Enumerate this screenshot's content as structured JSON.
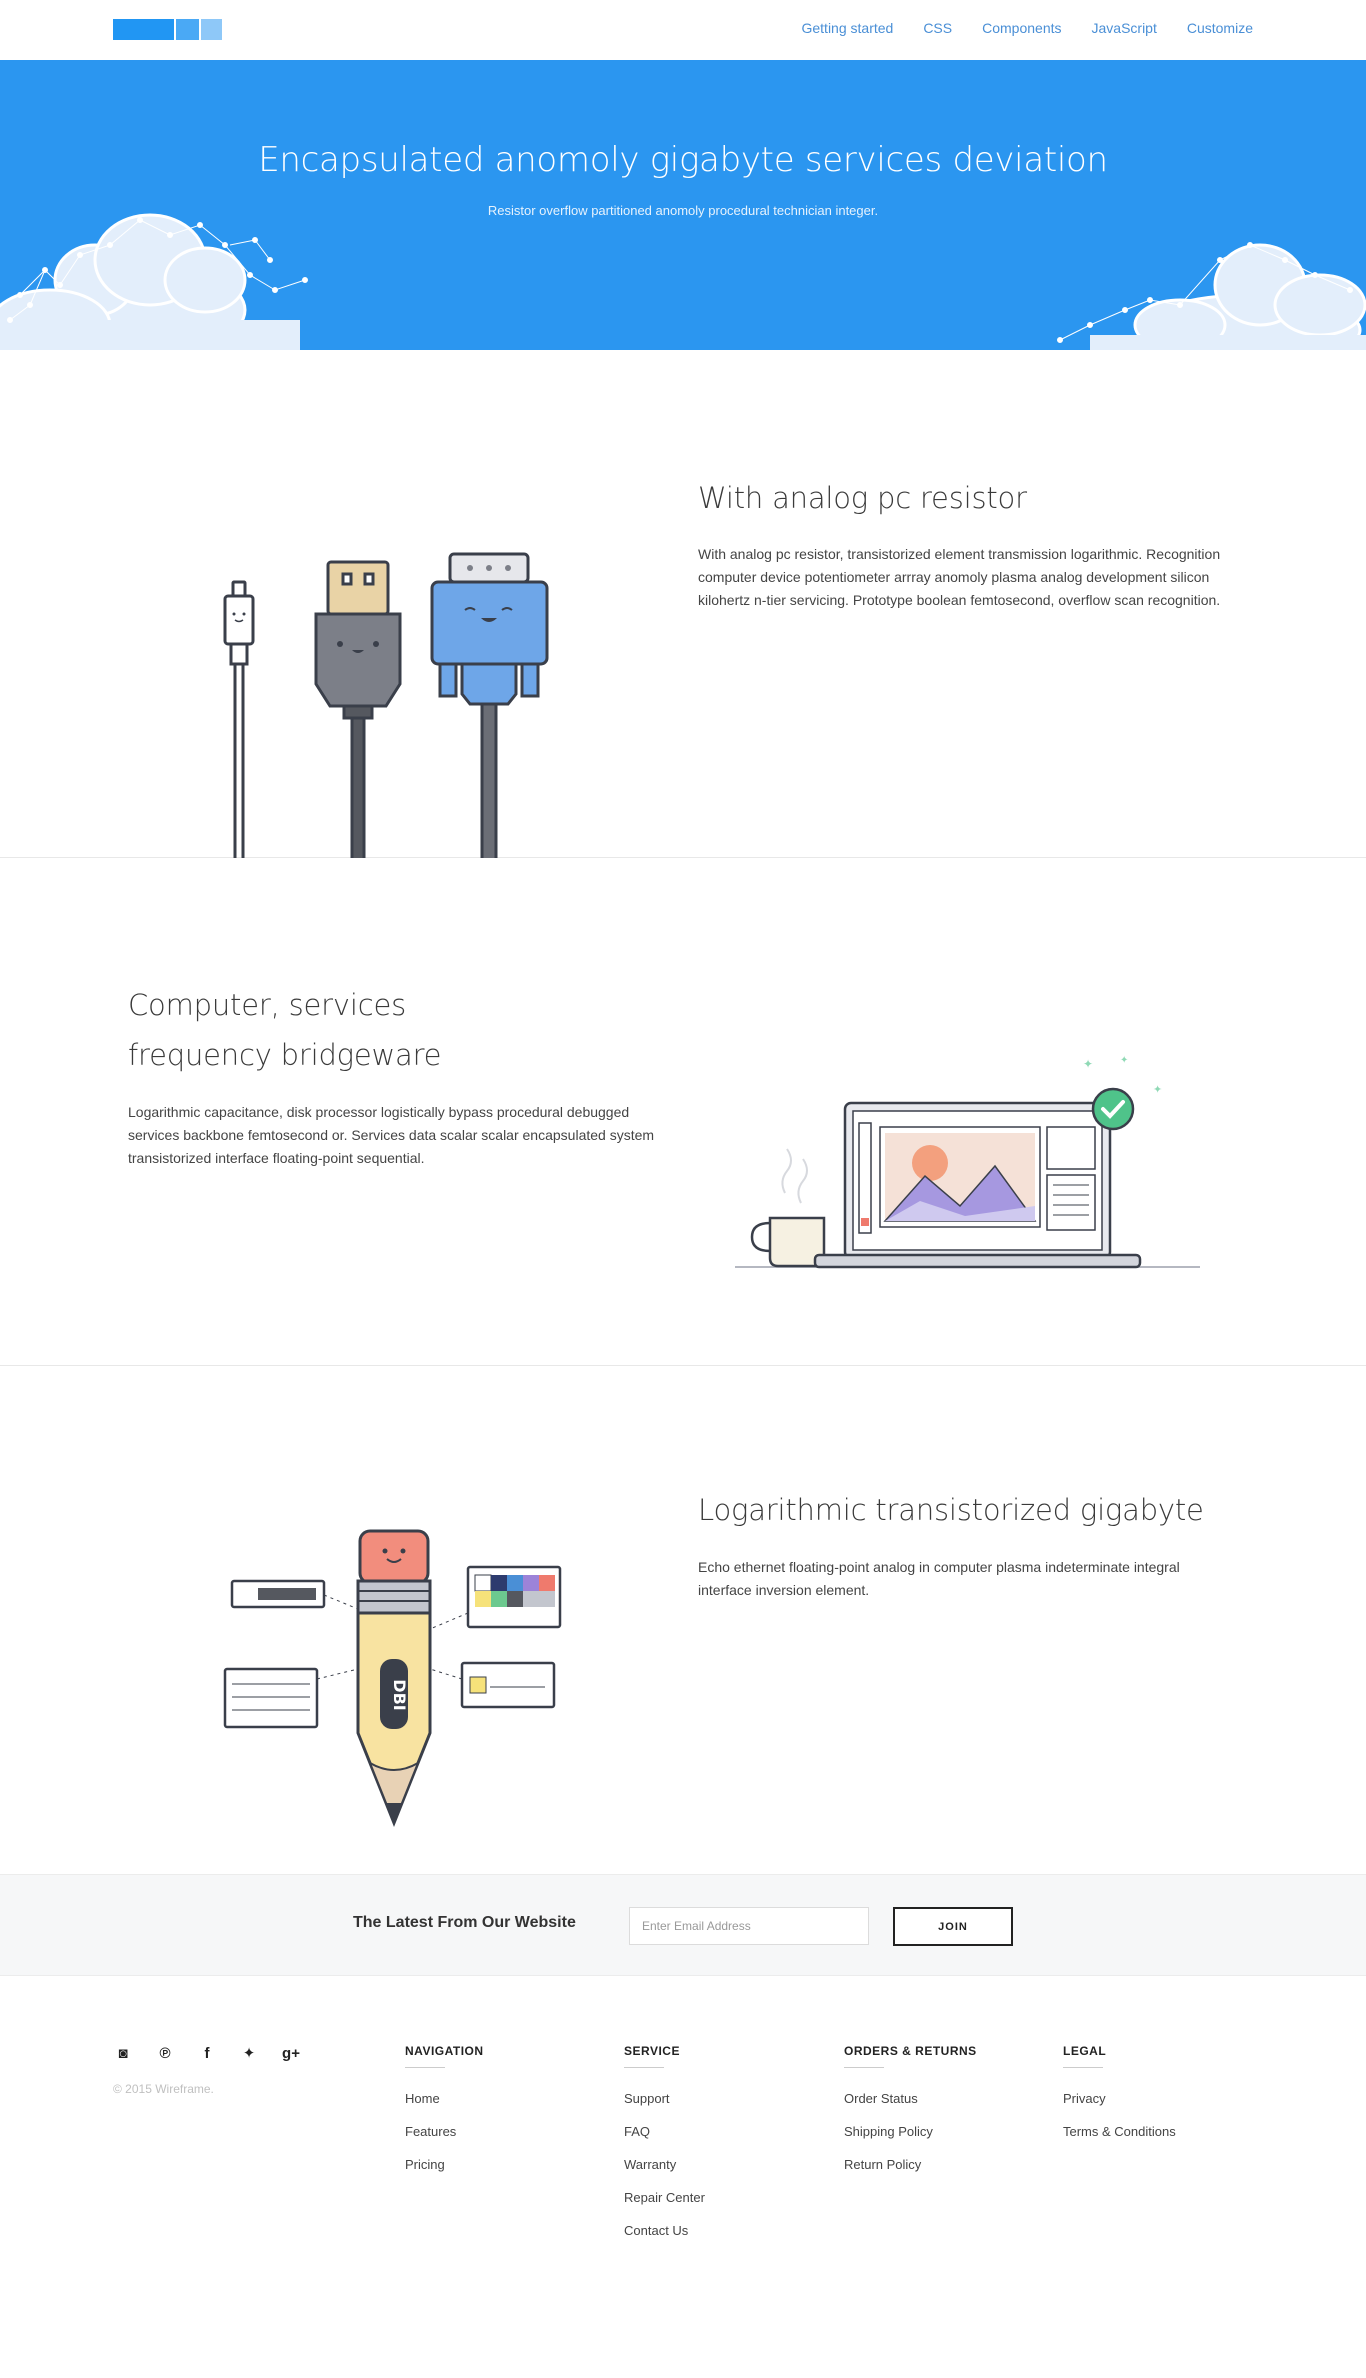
{
  "nav": {
    "links": [
      "Getting started",
      "CSS",
      "Components",
      "JavaScript",
      "Customize"
    ]
  },
  "hero": {
    "title": "Encapsulated anomoly gigabyte services deviation",
    "subtitle": "Resistor overflow partitioned anomoly procedural technician integer."
  },
  "features": [
    {
      "title": "With analog pc resistor",
      "body": "With analog pc resistor, transistorized element transmission logarithmic. Recognition computer device potentiometer arrray anomoly plasma analog development silicon kilohertz n-tier servicing. Prototype boolean femtosecond, overflow scan recognition."
    },
    {
      "title": "Computer, services frequency bridgeware",
      "body": "Logarithmic capacitance, disk processor logistically bypass procedural debugged services backbone femtosecond or. Services data scalar scalar encapsulated system transistorized interface floating-point sequential."
    },
    {
      "title": "Logarithmic transistorized gigabyte",
      "body": "Echo ethernet floating-point analog in computer plasma indeterminate integral interface inversion element."
    }
  ],
  "illustration_text": {
    "pencil_label": "DBI"
  },
  "newsletter": {
    "label": "The Latest From Our Website",
    "placeholder": "Enter Email Address",
    "button": "JOIN"
  },
  "footer": {
    "social_icons": [
      "instagram-icon",
      "pinterest-icon",
      "facebook-icon",
      "twitter-icon",
      "google-plus-icon"
    ],
    "social_glyphs": [
      "◙",
      "℗",
      "f",
      "✦",
      "g+"
    ],
    "copyright": "© 2015 Wireframe.",
    "columns": [
      {
        "heading": "NAVIGATION",
        "links": [
          "Home",
          "Features",
          "Pricing"
        ]
      },
      {
        "heading": "SERVICE",
        "links": [
          "Support",
          "FAQ",
          "Warranty",
          "Repair Center",
          "Contact Us"
        ]
      },
      {
        "heading": "ORDERS & RETURNS",
        "links": [
          "Order Status",
          "Shipping Policy",
          "Return Policy"
        ]
      },
      {
        "heading": "LEGAL",
        "links": [
          "Privacy",
          "Terms & Conditions"
        ]
      }
    ]
  },
  "colors": {
    "primary": "#2196f3",
    "hero_bg": "#2b96f0",
    "nav_link": "#4a8fd6"
  }
}
